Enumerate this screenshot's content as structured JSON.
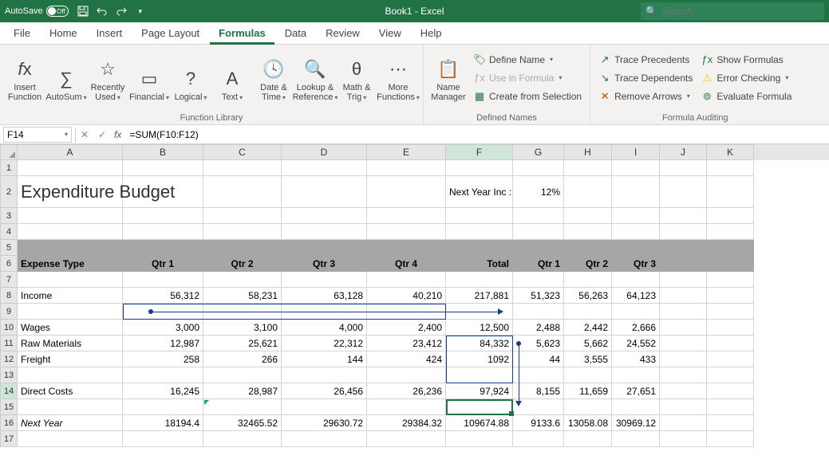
{
  "titlebar": {
    "autosave_label": "AutoSave",
    "autosave_state": "Off",
    "title": "Book1 - Excel",
    "search_placeholder": "Search"
  },
  "tabs": [
    "File",
    "Home",
    "Insert",
    "Page Layout",
    "Formulas",
    "Data",
    "Review",
    "View",
    "Help"
  ],
  "active_tab": "Formulas",
  "ribbon": {
    "insert_function": "Insert\nFunction",
    "autosum": "AutoSum",
    "recently_used": "Recently\nUsed",
    "financial": "Financial",
    "logical": "Logical",
    "text": "Text",
    "date_time": "Date &\nTime",
    "lookup_ref": "Lookup &\nReference",
    "math_trig": "Math &\nTrig",
    "more_fn": "More\nFunctions",
    "group_library": "Function Library",
    "name_mgr": "Name\nManager",
    "define_name": "Define Name",
    "use_in_formula": "Use in Formula",
    "create_selection": "Create from Selection",
    "group_names": "Defined Names",
    "trace_prec": "Trace Precedents",
    "trace_dep": "Trace Dependents",
    "remove_arrows": "Remove Arrows",
    "show_formulas": "Show Formulas",
    "error_check": "Error Checking",
    "eval_formula": "Evaluate Formula",
    "group_audit": "Formula Auditing"
  },
  "formula_bar": {
    "name_box": "F14",
    "formula": "=SUM(F10:F12)"
  },
  "columns": [
    "A",
    "B",
    "C",
    "D",
    "E",
    "F",
    "G",
    "H",
    "I",
    "J",
    "K"
  ],
  "sheet": {
    "title": "Expenditure Budget",
    "next_year_label": "Next Year Inc :",
    "next_year_val": "12%",
    "headers": [
      "Expense Type",
      "Qtr 1",
      "Qtr 2",
      "Qtr 3",
      "Qtr 4",
      "Total",
      "Qtr 1",
      "Qtr 2",
      "Qtr 3"
    ],
    "r8": {
      "a": "Income",
      "b": "56,312",
      "c": "58,231",
      "d": "63,128",
      "e": "40,210",
      "f": "217,881",
      "g": "51,323",
      "h": "56,263",
      "i": "64,123"
    },
    "r10": {
      "a": "Wages",
      "b": "3,000",
      "c": "3,100",
      "d": "4,000",
      "e": "2,400",
      "f": "12,500",
      "g": "2,488",
      "h": "2,442",
      "i": "2,666"
    },
    "r11": {
      "a": "Raw Materials",
      "b": "12,987",
      "c": "25,621",
      "d": "22,312",
      "e": "23,412",
      "f": "84,332",
      "g": "5,623",
      "h": "5,662",
      "i": "24,552"
    },
    "r12": {
      "a": "Freight",
      "b": "258",
      "c": "266",
      "d": "144",
      "e": "424",
      "f": "1092",
      "g": "44",
      "h": "3,555",
      "i": "433"
    },
    "r14": {
      "a": "Direct Costs",
      "b": "16,245",
      "c": "28,987",
      "d": "26,456",
      "e": "26,236",
      "f": "97,924",
      "g": "8,155",
      "h": "11,659",
      "i": "27,651"
    },
    "r16": {
      "a": "Next Year",
      "b": "18194.4",
      "c": "32465.52",
      "d": "29630.72",
      "e": "29384.32",
      "f": "109674.88",
      "g": "9133.6",
      "h": "13058.08",
      "i": "30969.12"
    }
  }
}
